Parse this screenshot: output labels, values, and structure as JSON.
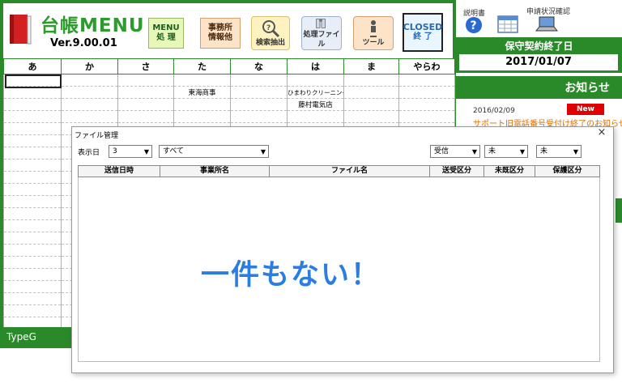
{
  "app": {
    "title": "台帳MENU",
    "version": "Ver.9.00.01"
  },
  "toolbar": {
    "menu_line1": "MENU",
    "menu_line2": "処 理",
    "office_line1": "事務所",
    "office_line2": "情報他",
    "search_label": "検索抽出",
    "process_label": "処理ファイル",
    "tool_label": "ツール",
    "closed_line1": "CLOSED",
    "closed_line2": "終 了"
  },
  "grid": {
    "headers": [
      "あ",
      "か",
      "さ",
      "た",
      "な",
      "は",
      "ま",
      "やらわ"
    ],
    "row1": [
      "",
      "",
      "",
      "東海商事",
      "",
      "ひまわりクリーニング",
      "",
      ""
    ],
    "row2": [
      "",
      "",
      "",
      "",
      "",
      "藤村電気店",
      "",
      ""
    ]
  },
  "status": {
    "type_label": "TypeG"
  },
  "right_panel": {
    "manual_label": "説明書",
    "request_status_label": "申請状況確認",
    "contract_title": "保守契約終了日",
    "contract_date": "2017/01/07",
    "news_title": "お知らせ",
    "news_date": "2016/02/09",
    "news_badge": "New",
    "news_text": "サポート旧電話番号受付け終了のお知らせ"
  },
  "dialog": {
    "title": "ファイル管理",
    "close_symbol": "×",
    "day_label": "表示日",
    "days_value": "3",
    "filter_all_value": "すべて",
    "direction_value": "受信",
    "unread_value": "未",
    "saved_value": "未",
    "columns": [
      "送信日時",
      "事業所名",
      "ファイル名",
      "送受区分",
      "未既区分",
      "保護区分"
    ],
    "empty_message": "一件もない！"
  },
  "colors": {
    "brand_green": "#2a8a2a",
    "empty_message_blue": "#2b7ee0",
    "news_badge_red": "#e00000",
    "news_link_orange": "#e07000"
  }
}
